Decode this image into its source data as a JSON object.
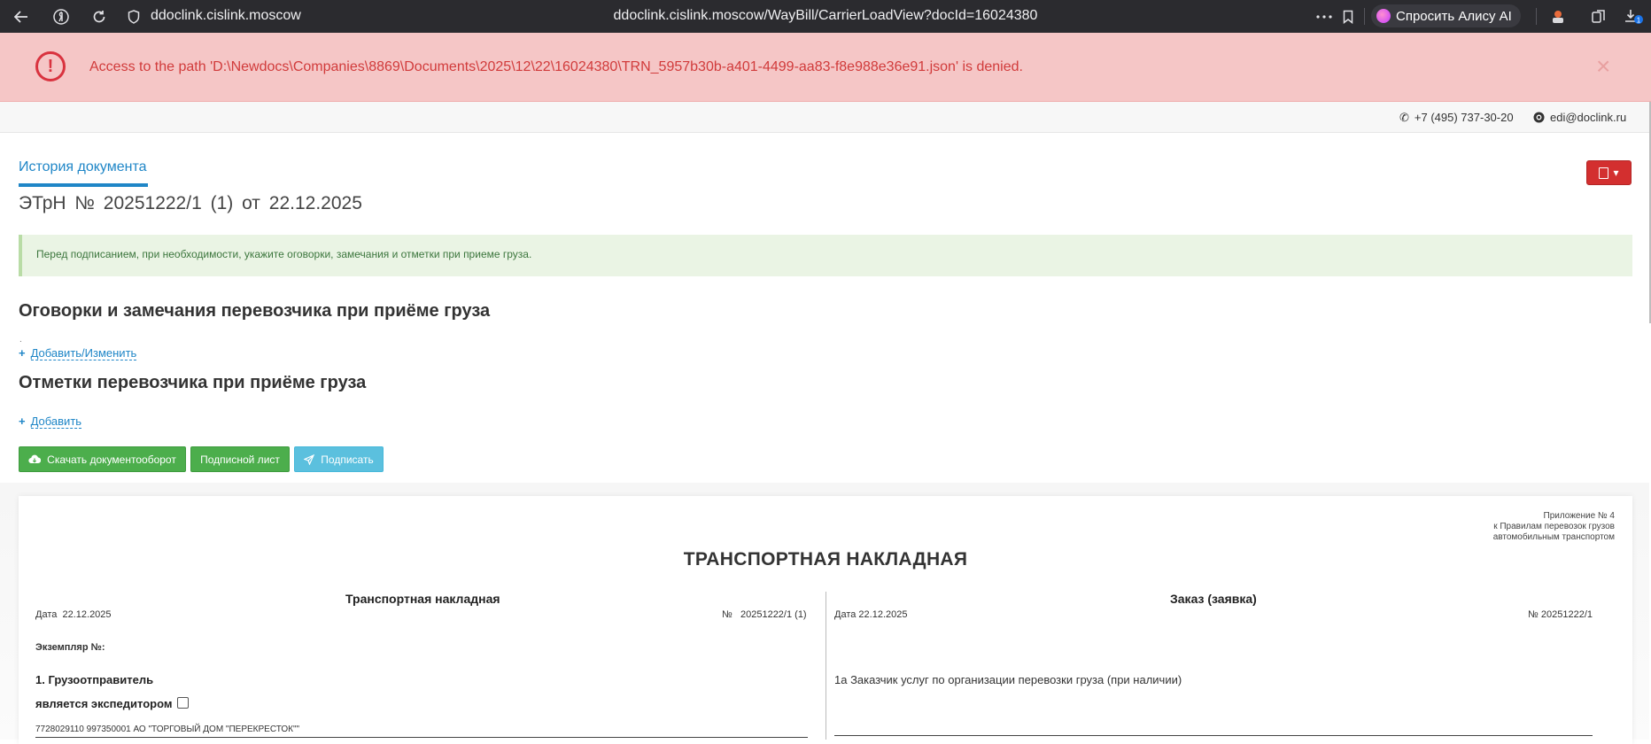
{
  "browser": {
    "domain": "ddoclink.cislink.moscow",
    "url": "ddoclink.cislink.moscow/WayBill/CarrierLoadView?docId=16024380",
    "alisa_label": "Спросить Алису AI",
    "download_badge": "1"
  },
  "error": {
    "message": "Access to the path 'D:\\Newdocs\\Companies\\8869\\Documents\\2025\\12\\22\\16024380\\TRN_5957b30b-a401-4499-aa83-f8e988e36e91.json' is denied.",
    "icon_glyph": "!",
    "close_glyph": "×"
  },
  "contacts": {
    "phone": "+7 (495) 737-30-20",
    "email": "edi@doclink.ru"
  },
  "header": {
    "history_tab": "История документа",
    "doc_prefix": "ЭТрН №",
    "doc_number": "20251222/1 (1)",
    "doc_from": "от",
    "doc_date": "22.12.2025"
  },
  "info_text": "Перед подписанием, при необходимости, укажите оговорки, замечания и отметки при приеме груза.",
  "sections": {
    "remarks_title": "Оговорки и замечания перевозчика при приёме груза",
    "remarks_dot": ".",
    "remarks_add": "Добавить/Изменить",
    "marks_title": "Отметки перевозчика при приёме груза",
    "marks_add": "Добавить"
  },
  "buttons": {
    "download": "Скачать документооборот",
    "sign_sheet": "Подписной лист",
    "sign": "Подписать"
  },
  "document": {
    "appendix_line1": "Приложение № 4",
    "appendix_line2": "к Правилам перевозок грузов",
    "appendix_line3": "автомобильным транспортом",
    "title": "ТРАНСПОРТНАЯ НАКЛАДНАЯ",
    "left": {
      "title": "Транспортная накладная",
      "date_label": "Дата",
      "date": "22.12.2025",
      "no_label": "№",
      "number": "20251222/1 (1)",
      "copy_label": "Экземпляр №:",
      "shipper_title": "1. Грузоотправитель",
      "forwarder_label": "является экспедитором",
      "shipper_value": "7728029110 997350001 АО \"ТОРГОВЫЙ ДОМ \"ПЕРЕКРЕСТОК\"\""
    },
    "right": {
      "title": "Заказ (заявка)",
      "date_label": "Дата",
      "date": "22.12.2025",
      "no_label": "№",
      "number": "20251222/1",
      "customer_title": "1а Заказчик услуг по организации перевозки груза (при наличии)"
    }
  }
}
